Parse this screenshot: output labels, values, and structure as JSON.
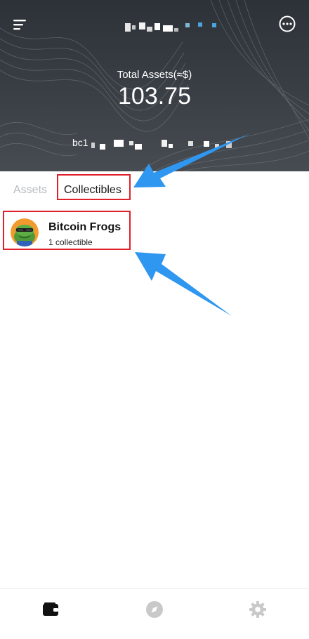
{
  "header": {
    "total_label": "Total Assets(≈$)",
    "total_value": "103.75",
    "address_prefix": "bc1"
  },
  "tabs": [
    {
      "label": "Assets",
      "active": false
    },
    {
      "label": "Collectibles",
      "active": true
    }
  ],
  "collectibles": [
    {
      "name": "Bitcoin Frogs",
      "count_label": "1 collectible",
      "icon": "frog-avatar-icon"
    }
  ],
  "bottom_nav": [
    {
      "icon": "wallet-icon",
      "active": true
    },
    {
      "icon": "compass-icon",
      "active": false
    },
    {
      "icon": "gear-icon",
      "active": false
    }
  ],
  "colors": {
    "header_bg": "#2d3238",
    "annotation_box": "#e0202a",
    "annotation_arrow": "#2f97f0",
    "tab_inactive": "#b9bcc1",
    "tab_active": "#1a1a1a"
  }
}
